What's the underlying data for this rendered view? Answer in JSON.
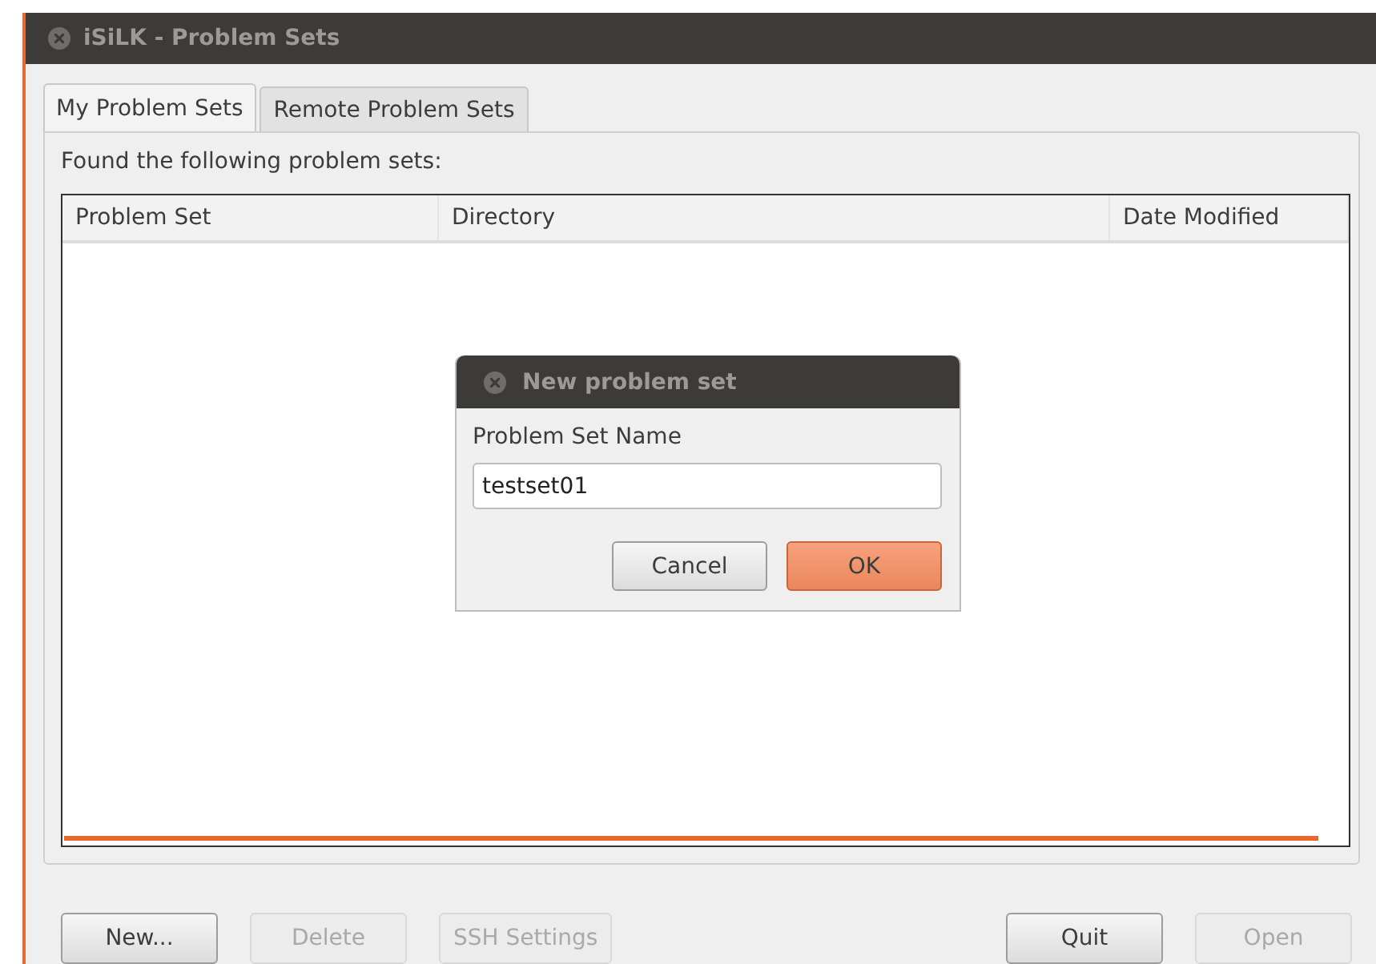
{
  "window": {
    "title": "iSiLK - Problem Sets"
  },
  "tabs": [
    {
      "label": "My Problem Sets",
      "selected": true
    },
    {
      "label": "Remote Problem Sets",
      "selected": false
    }
  ],
  "caption": "Found the following problem sets:",
  "table": {
    "columns": [
      "Problem Set",
      "Directory",
      "Date Modified"
    ]
  },
  "left_buttons": [
    {
      "label": "New...",
      "disabled": false
    },
    {
      "label": "Delete",
      "disabled": true
    },
    {
      "label": "SSH Settings",
      "disabled": true
    }
  ],
  "right_buttons": [
    {
      "label": "Quit",
      "disabled": false
    },
    {
      "label": "Open",
      "disabled": true
    }
  ],
  "dialog": {
    "title": "New problem set",
    "field_label": "Problem Set Name",
    "value": "testset01",
    "buttons": [
      {
        "label": "Cancel",
        "default": false
      },
      {
        "label": "OK",
        "default": true
      }
    ]
  }
}
